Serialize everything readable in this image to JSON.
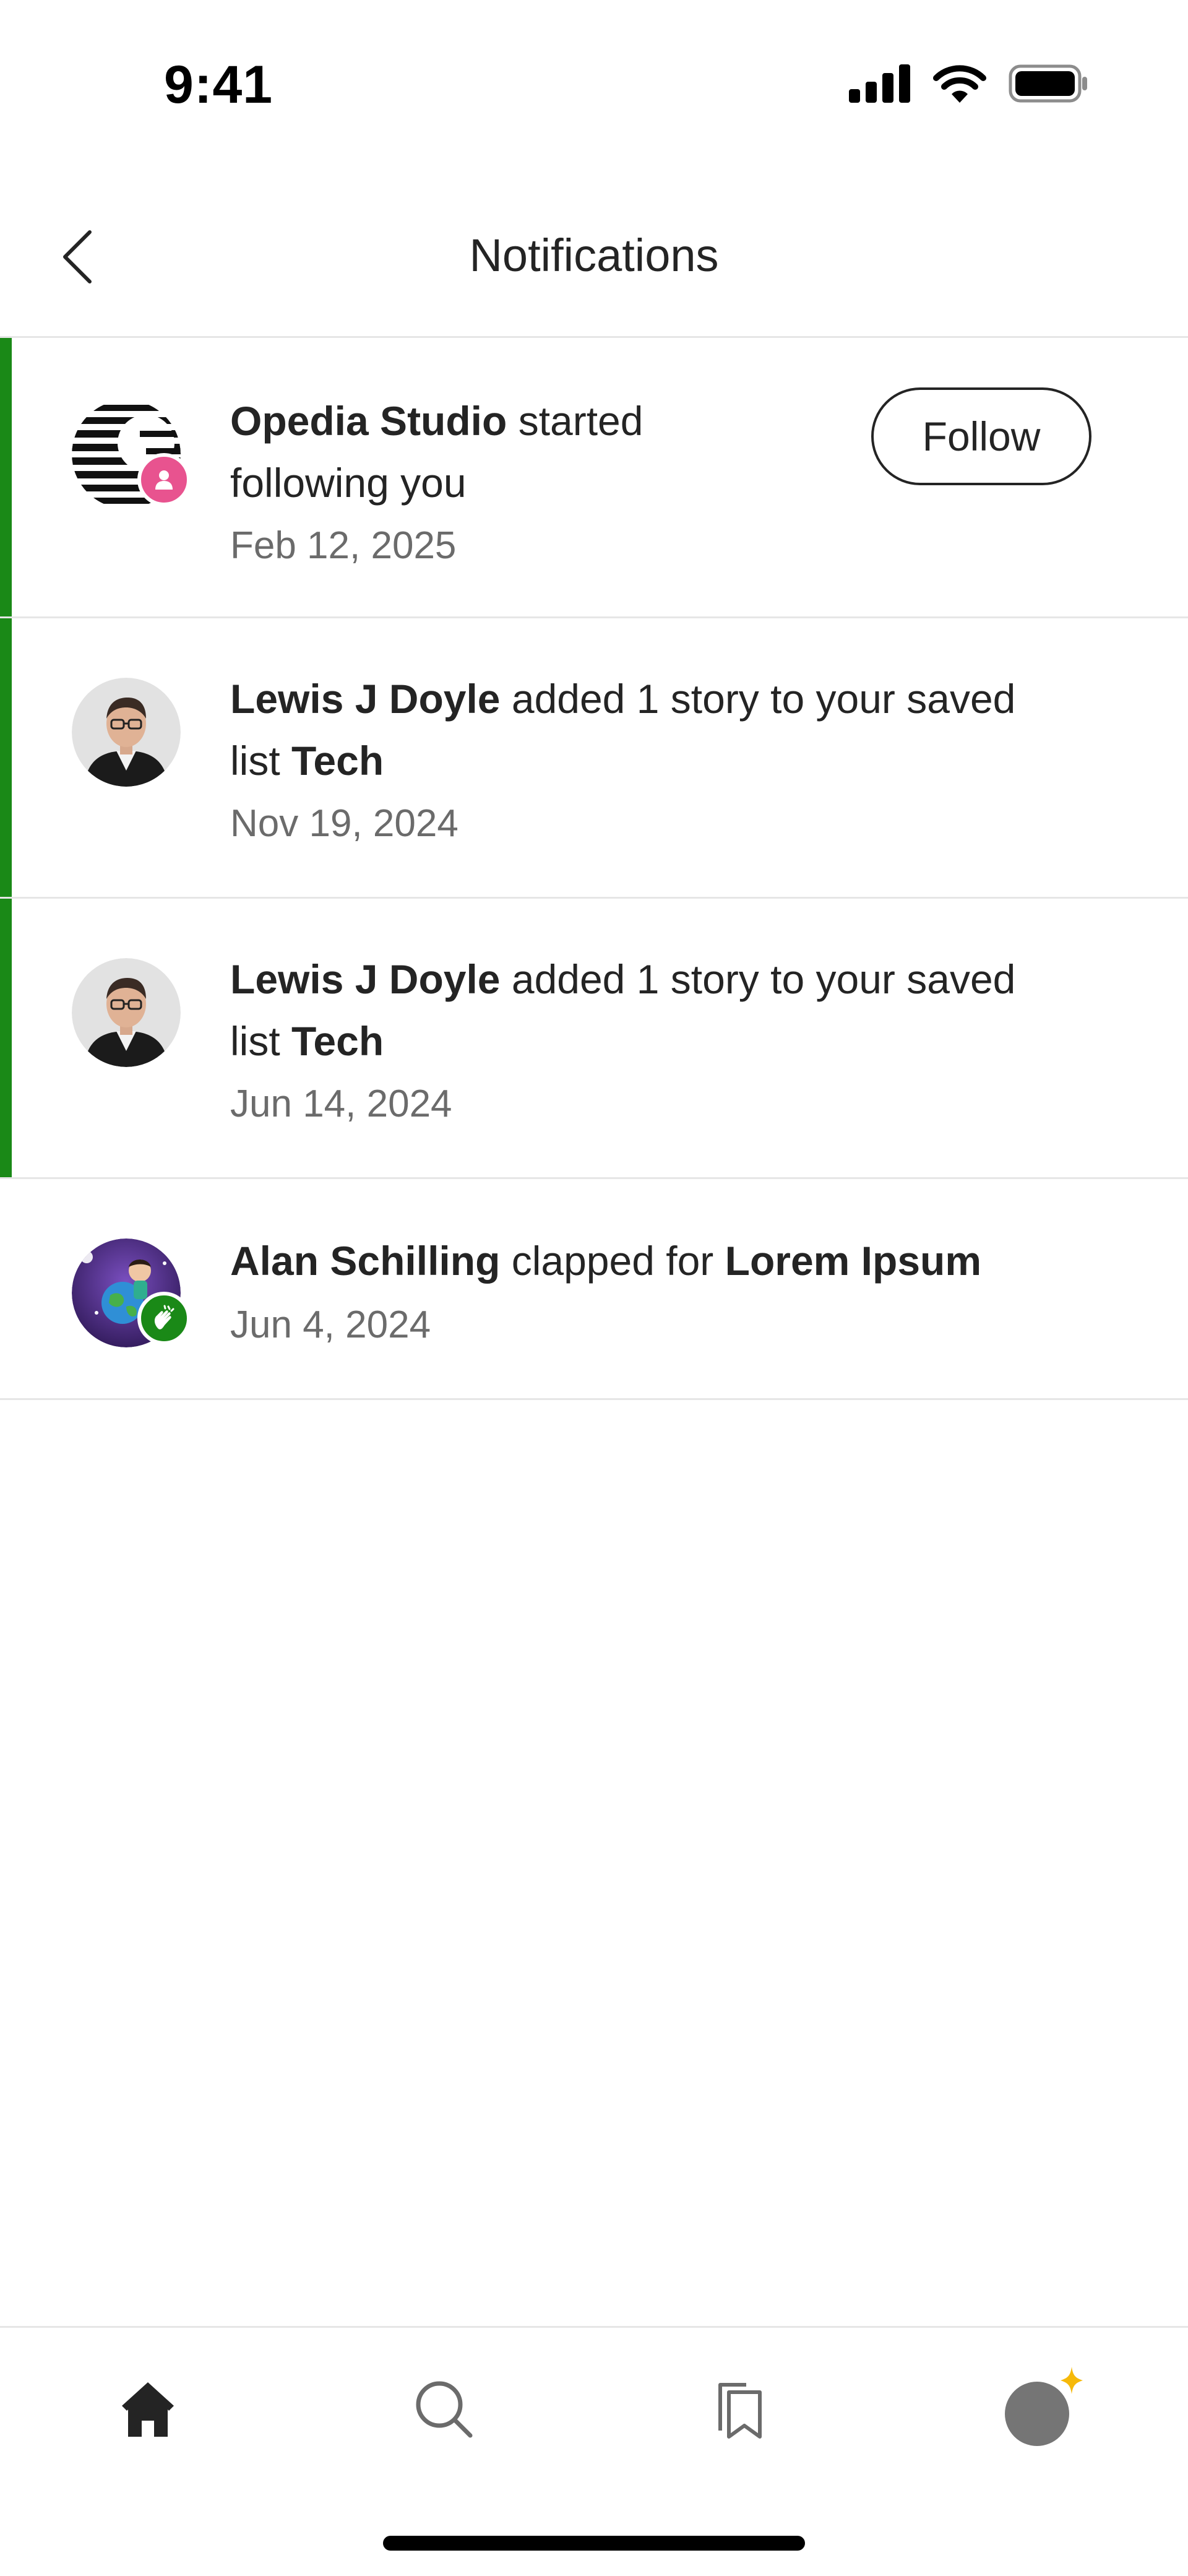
{
  "status_bar": {
    "time": "9:41"
  },
  "header": {
    "title": "Notifications"
  },
  "notifications": [
    {
      "actor": "Opedia Studio",
      "line1_text": "started",
      "line2_text": "following you",
      "date": "Feb 12, 2025",
      "button": "Follow",
      "badge_icon": "person-icon",
      "unread": true
    },
    {
      "actor": "Lewis J Doyle",
      "line1_text": "added 1 story to your saved",
      "line2_prefix": "list",
      "line2_strong": "Tech",
      "date": "Nov 19, 2024",
      "unread": true
    },
    {
      "actor": "Lewis J Doyle",
      "line1_text": "added 1 story to your saved",
      "line2_prefix": "list",
      "line2_strong": "Tech",
      "date": "Jun 14, 2024",
      "unread": true
    },
    {
      "actor": "Alan Schilling",
      "line1_text": "clapped for",
      "line1_strong": "Lorem Ipsum",
      "date": "Jun 4, 2024",
      "badge_icon": "clap-icon",
      "unread": false
    }
  ],
  "tab_bar": {
    "items": [
      "home-icon",
      "search-icon",
      "bookmarks-icon",
      "profile-icon"
    ],
    "active": "home-icon"
  },
  "colors": {
    "unread_accent": "#1a8917",
    "follow_badge": "#e8538f",
    "clap_badge": "#1a8917",
    "sparkle": "#f6b90a"
  }
}
